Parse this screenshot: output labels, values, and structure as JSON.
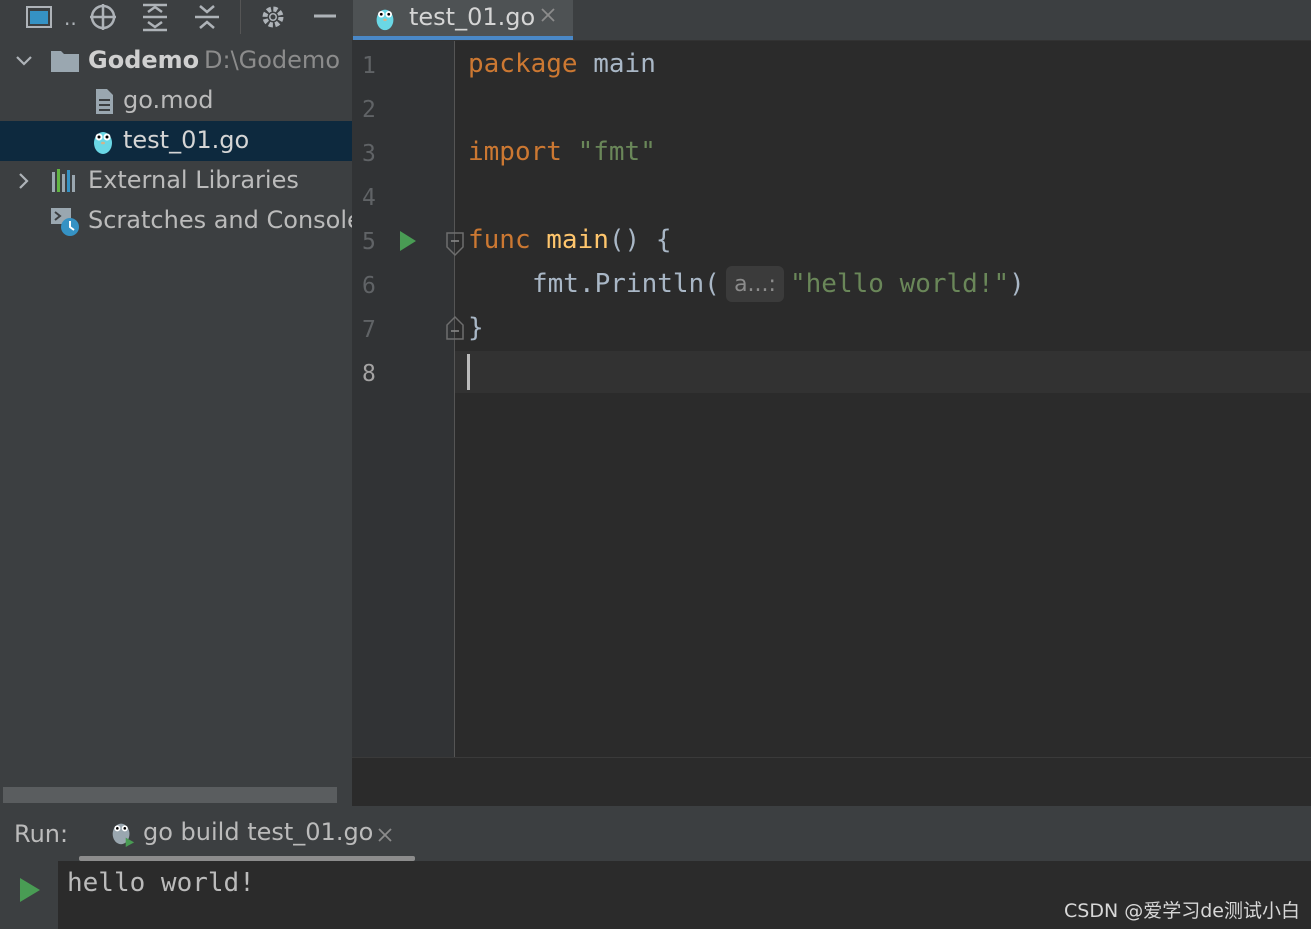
{
  "project": {
    "root_name": "Godemo",
    "root_path": "D:\\Godemo",
    "items": [
      {
        "label": "go.mod"
      },
      {
        "label": "test_01.go"
      },
      {
        "label": "External Libraries"
      },
      {
        "label": "Scratches and Consoles"
      }
    ]
  },
  "editor": {
    "tab_label": "test_01.go",
    "line_numbers": [
      "1",
      "2",
      "3",
      "4",
      "5",
      "6",
      "7",
      "8"
    ],
    "code": {
      "l1_kw": "package",
      "l1_rest": " main",
      "l3_kw": "import",
      "l3_str": " \"fmt\"",
      "l5_kw": "func",
      "l5_fn": " main",
      "l5_rest": "() {",
      "l6_pre": "fmt.Println(",
      "l6_hint": "a...:",
      "l6_str": "\"hello world!\"",
      "l6_post": ")",
      "l7": "}"
    }
  },
  "run": {
    "title": "Run:",
    "tab_label": "go build test_01.go",
    "output": "hello world!"
  },
  "watermark": "CSDN @爱学习de测试小白",
  "colors": {
    "keyword": "#cc7832",
    "string": "#6a8759",
    "function": "#ffc66d",
    "run_green": "#499c54",
    "selection": "#0d293e",
    "tab_accent": "#4a88c7"
  }
}
